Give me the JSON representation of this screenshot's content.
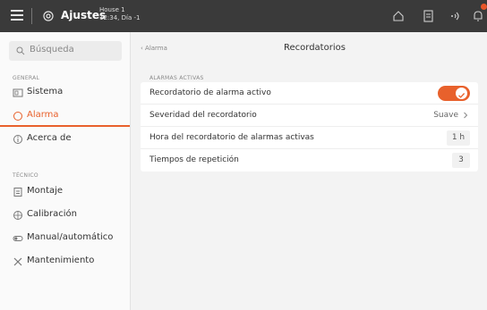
{
  "topbar": {
    "title": "Ajustes",
    "house": "House 1",
    "time_day": "12:34, Día -1",
    "icons": [
      "home-icon",
      "document-icon",
      "wireless-icon",
      "bell-icon"
    ],
    "accent": "#e8612c"
  },
  "sidebar": {
    "search_placeholder": "Búsqueda",
    "general_label": "GENERAL",
    "tecnico_label": "TÉCNICO",
    "general_items": [
      {
        "label": "Sistema",
        "icon": "system-icon"
      },
      {
        "label": "Alarma",
        "icon": "alarm-icon",
        "active": true
      },
      {
        "label": "Acerca de",
        "icon": "info-icon"
      }
    ],
    "tecnico_items": [
      {
        "label": "Montaje",
        "icon": "mounting-icon"
      },
      {
        "label": "Calibración",
        "icon": "calibration-icon"
      },
      {
        "label": "Manual/automático",
        "icon": "manual-auto-icon"
      },
      {
        "label": "Mantenimiento",
        "icon": "maintenance-icon"
      }
    ]
  },
  "main": {
    "back_label": "Alarma",
    "title": "Recordatorios",
    "group_label": "ALARMAS ACTIVAS",
    "rows": [
      {
        "label": "Recordatorio de alarma activo",
        "toggle": true
      },
      {
        "label": "Severidad del recordatorio",
        "value": "Suave"
      },
      {
        "label": "Hora del recordatorio de alarmas activas",
        "value": "1 h"
      },
      {
        "label": "Tiempos de repetición",
        "value": "3"
      }
    ]
  }
}
